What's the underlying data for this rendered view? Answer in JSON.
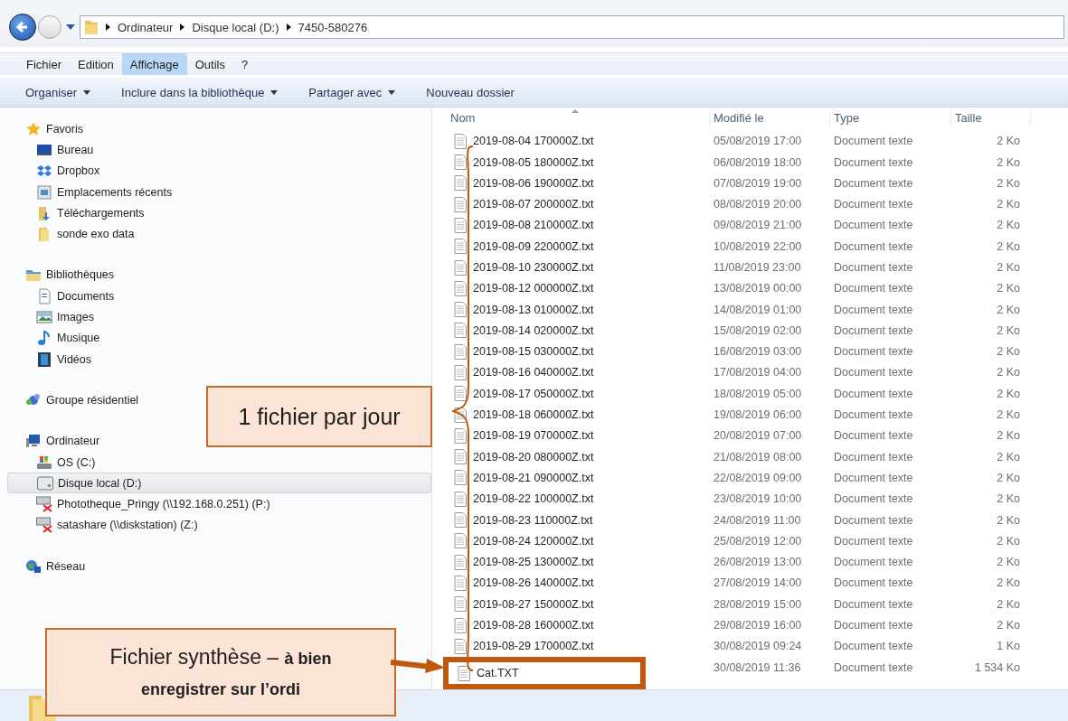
{
  "address_bar": {
    "path": [
      "Ordinateur",
      "Disque local (D:)",
      "7450-580276"
    ]
  },
  "menu": [
    {
      "label": "Fichier",
      "selected": false
    },
    {
      "label": "Edition",
      "selected": false
    },
    {
      "label": "Affichage",
      "selected": true
    },
    {
      "label": "Outils",
      "selected": false
    },
    {
      "label": "?",
      "selected": false
    }
  ],
  "toolbar": [
    {
      "label": "Organiser",
      "dropdown": true
    },
    {
      "label": "Inclure dans la bibliothèque",
      "dropdown": true
    },
    {
      "label": "Partager avec",
      "dropdown": true
    },
    {
      "label": "Nouveau dossier",
      "dropdown": false
    }
  ],
  "sidebar": {
    "groups": [
      {
        "label": "Favoris",
        "kind": "star",
        "selected": false,
        "children": [
          {
            "label": "Bureau",
            "kind": "desktop",
            "selected": false
          },
          {
            "label": "Dropbox",
            "kind": "dropbox",
            "selected": false
          },
          {
            "label": "Emplacements récents",
            "kind": "recent",
            "selected": false
          },
          {
            "label": "Téléchargements",
            "kind": "download",
            "selected": false
          },
          {
            "label": "sonde exo data",
            "kind": "folder",
            "selected": false
          }
        ]
      },
      {
        "label": "Bibliothèques",
        "kind": "library",
        "selected": false,
        "children": [
          {
            "label": "Documents",
            "kind": "document",
            "selected": false
          },
          {
            "label": "Images",
            "kind": "images",
            "selected": false
          },
          {
            "label": "Musique",
            "kind": "music",
            "selected": false
          },
          {
            "label": "Vidéos",
            "kind": "video",
            "selected": false
          }
        ]
      },
      {
        "label": "Groupe résidentiel",
        "kind": "homegroup",
        "selected": false
      },
      {
        "label": "Ordinateur",
        "kind": "computer",
        "selected": false,
        "children": [
          {
            "label": "OS (C:)",
            "kind": "osdrive",
            "selected": false
          },
          {
            "label": "Disque local (D:)",
            "kind": "drive",
            "selected": true
          },
          {
            "label": "Phototheque_Pringy (\\\\192.168.0.251) (P:)",
            "kind": "netdrive",
            "selected": false
          },
          {
            "label": "satashare (\\\\diskstation) (Z:)",
            "kind": "netdrive",
            "selected": false
          }
        ]
      },
      {
        "label": "Réseau",
        "kind": "network",
        "selected": false
      }
    ]
  },
  "file_list": {
    "columns": [
      "Nom",
      "Modifié le",
      "Type",
      "Taille"
    ],
    "rows": [
      {
        "name": "2019-08-04 170000Z.txt",
        "modified": "05/08/2019 17:00",
        "type": "Document texte",
        "size": "2 Ko",
        "highlighted": false
      },
      {
        "name": "2019-08-05 180000Z.txt",
        "modified": "06/08/2019 18:00",
        "type": "Document texte",
        "size": "2 Ko",
        "highlighted": false
      },
      {
        "name": "2019-08-06 190000Z.txt",
        "modified": "07/08/2019 19:00",
        "type": "Document texte",
        "size": "2 Ko",
        "highlighted": false
      },
      {
        "name": "2019-08-07 200000Z.txt",
        "modified": "08/08/2019 20:00",
        "type": "Document texte",
        "size": "2 Ko",
        "highlighted": false
      },
      {
        "name": "2019-08-08 210000Z.txt",
        "modified": "09/08/2019 21:00",
        "type": "Document texte",
        "size": "2 Ko",
        "highlighted": false
      },
      {
        "name": "2019-08-09 220000Z.txt",
        "modified": "10/08/2019 22:00",
        "type": "Document texte",
        "size": "2 Ko",
        "highlighted": false
      },
      {
        "name": "2019-08-10 230000Z.txt",
        "modified": "11/08/2019 23:00",
        "type": "Document texte",
        "size": "2 Ko",
        "highlighted": false
      },
      {
        "name": "2019-08-12 000000Z.txt",
        "modified": "13/08/2019 00:00",
        "type": "Document texte",
        "size": "2 Ko",
        "highlighted": false
      },
      {
        "name": "2019-08-13 010000Z.txt",
        "modified": "14/08/2019 01:00",
        "type": "Document texte",
        "size": "2 Ko",
        "highlighted": false
      },
      {
        "name": "2019-08-14 020000Z.txt",
        "modified": "15/08/2019 02:00",
        "type": "Document texte",
        "size": "2 Ko",
        "highlighted": false
      },
      {
        "name": "2019-08-15 030000Z.txt",
        "modified": "16/08/2019 03:00",
        "type": "Document texte",
        "size": "2 Ko",
        "highlighted": false
      },
      {
        "name": "2019-08-16 040000Z.txt",
        "modified": "17/08/2019 04:00",
        "type": "Document texte",
        "size": "2 Ko",
        "highlighted": false
      },
      {
        "name": "2019-08-17 050000Z.txt",
        "modified": "18/08/2019 05:00",
        "type": "Document texte",
        "size": "2 Ko",
        "highlighted": false
      },
      {
        "name": "2019-08-18 060000Z.txt",
        "modified": "19/08/2019 06:00",
        "type": "Document texte",
        "size": "2 Ko",
        "highlighted": false
      },
      {
        "name": "2019-08-19 070000Z.txt",
        "modified": "20/08/2019 07:00",
        "type": "Document texte",
        "size": "2 Ko",
        "highlighted": false
      },
      {
        "name": "2019-08-20 080000Z.txt",
        "modified": "21/08/2019 08:00",
        "type": "Document texte",
        "size": "2 Ko",
        "highlighted": false
      },
      {
        "name": "2019-08-21 090000Z.txt",
        "modified": "22/08/2019 09:00",
        "type": "Document texte",
        "size": "2 Ko",
        "highlighted": false
      },
      {
        "name": "2019-08-22 100000Z.txt",
        "modified": "23/08/2019 10:00",
        "type": "Document texte",
        "size": "2 Ko",
        "highlighted": false
      },
      {
        "name": "2019-08-23 110000Z.txt",
        "modified": "24/08/2019 11:00",
        "type": "Document texte",
        "size": "2 Ko",
        "highlighted": false
      },
      {
        "name": "2019-08-24 120000Z.txt",
        "modified": "25/08/2019 12:00",
        "type": "Document texte",
        "size": "2 Ko",
        "highlighted": false
      },
      {
        "name": "2019-08-25 130000Z.txt",
        "modified": "26/08/2019 13:00",
        "type": "Document texte",
        "size": "2 Ko",
        "highlighted": false
      },
      {
        "name": "2019-08-26 140000Z.txt",
        "modified": "27/08/2019 14:00",
        "type": "Document texte",
        "size": "2 Ko",
        "highlighted": false
      },
      {
        "name": "2019-08-27 150000Z.txt",
        "modified": "28/08/2019 15:00",
        "type": "Document texte",
        "size": "2 Ko",
        "highlighted": false
      },
      {
        "name": "2019-08-28 160000Z.txt",
        "modified": "29/08/2019 16:00",
        "type": "Document texte",
        "size": "2 Ko",
        "highlighted": false
      },
      {
        "name": "2019-08-29 170000Z.txt",
        "modified": "30/08/2019 09:24",
        "type": "Document texte",
        "size": "1 Ko",
        "highlighted": false
      },
      {
        "name": "Cat.TXT",
        "modified": "30/08/2019 11:36",
        "type": "Document texte",
        "size": "1 534 Ko",
        "highlighted": true
      }
    ]
  },
  "annotations": [
    {
      "kind": "brace",
      "text": "1 fichier par jour"
    },
    {
      "kind": "arrow",
      "text": "Fichier synthèse – **à bien enregistrer sur l’ordi**"
    }
  ]
}
